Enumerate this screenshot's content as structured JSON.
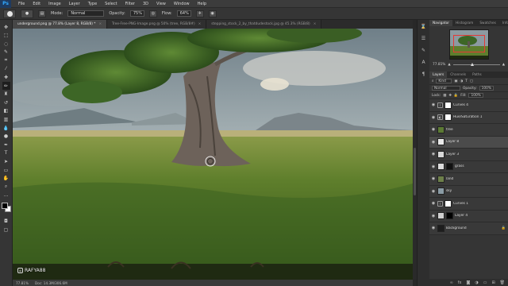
{
  "app": {
    "logo": "Ps"
  },
  "menu": [
    "File",
    "Edit",
    "Image",
    "Layer",
    "Type",
    "Select",
    "Filter",
    "3D",
    "View",
    "Window",
    "Help"
  ],
  "options": {
    "mode_label": "Mode:",
    "mode_value": "Normal",
    "opacity_label": "Opacity:",
    "opacity_value": "75%",
    "flow_label": "Flow:",
    "flow_value": "64%"
  },
  "tabs": [
    {
      "label": "underground.png @ 77.8% (Layer 8, RGB/8) *",
      "active": true
    },
    {
      "label": "Tree-Free-PNG-Image.png @ 50% (tree, RGB/8#)",
      "active": false
    },
    {
      "label": "stepping_stock_2_by_thatdudestock.jpg @ 45.3% (RGB/8)",
      "active": false
    }
  ],
  "status": {
    "zoom": "77.81%",
    "doc": "Doc: 14.3M/306.6M"
  },
  "watermark": "RAFYA88",
  "navigator": {
    "tabs": [
      "Navigator",
      "Histogram",
      "Swatches",
      "Info"
    ],
    "zoom": "77.81%"
  },
  "layers_panel": {
    "tabs": [
      "Layers",
      "Channels",
      "Paths"
    ],
    "kind_label": "Kind",
    "blend": "Normal",
    "opacity_label": "Opacity:",
    "opacity_value": "100%",
    "lock_label": "Lock:",
    "fill_label": "Fill:",
    "fill_value": "100%",
    "layers": [
      {
        "name": "Curves 4",
        "type": "adjustment",
        "selected": false
      },
      {
        "name": "Hue/Saturation 1",
        "type": "adjustment",
        "selected": false
      },
      {
        "name": "tree",
        "type": "pixel",
        "selected": false
      },
      {
        "name": "Layer 8",
        "type": "pixel",
        "selected": true
      },
      {
        "name": "Layer 3",
        "type": "pixel",
        "selected": false
      },
      {
        "name": "grass",
        "type": "pixel",
        "selected": false
      },
      {
        "name": "land",
        "type": "pixel",
        "selected": false
      },
      {
        "name": "sky",
        "type": "pixel",
        "selected": false
      },
      {
        "name": "Curves 1",
        "type": "adjustment",
        "selected": false
      },
      {
        "name": "Layer 4",
        "type": "pixel",
        "selected": false
      },
      {
        "name": "Background",
        "type": "pixel",
        "selected": false
      }
    ]
  },
  "colors": {
    "accent": "#31a8ff",
    "panel": "#353535",
    "selection": "#4b4b4b"
  }
}
